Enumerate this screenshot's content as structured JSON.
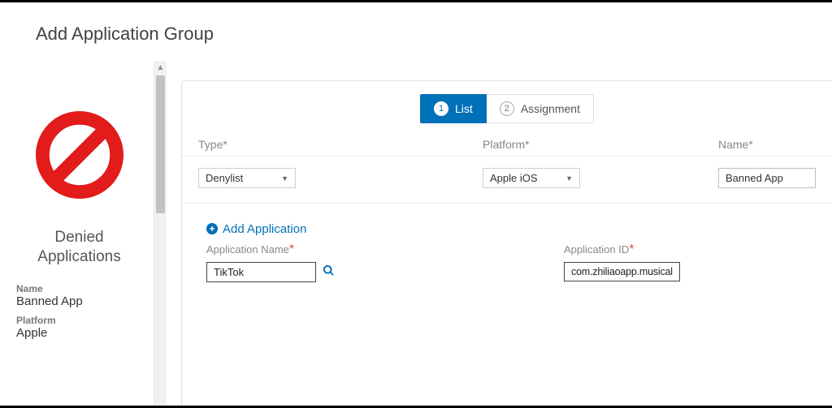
{
  "page": {
    "title": "Add Application Group"
  },
  "sidebar": {
    "title": "Denied Applications",
    "name_label": "Name",
    "name_value": "Banned App",
    "platform_label": "Platform",
    "platform_value": "Apple"
  },
  "steps": {
    "s1_num": "1",
    "s1_label": "List",
    "s2_num": "2",
    "s2_label": "Assignment"
  },
  "cols": {
    "type_label": "Type*",
    "platform_label": "Platform*",
    "name_label": "Name*",
    "type_value": "Denylist",
    "platform_value": "Apple iOS",
    "name_value": "Banned App"
  },
  "add_app": {
    "link": "Add Application",
    "name_label": "Application Name",
    "id_label": "Application ID",
    "name_value": "TikTok",
    "id_value": "com.zhiliaoapp.musically"
  }
}
